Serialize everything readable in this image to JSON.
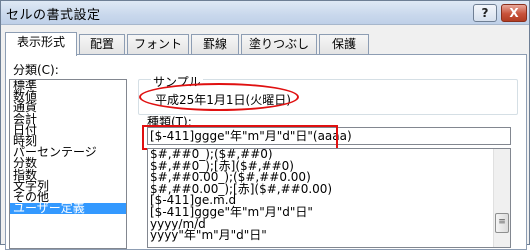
{
  "dialog": {
    "title": "セルの書式設定",
    "help_label": "?",
    "close_label": "X"
  },
  "tabs": [
    {
      "label": "表示形式",
      "active": true
    },
    {
      "label": "配置",
      "active": false
    },
    {
      "label": "フォント",
      "active": false
    },
    {
      "label": "罫線",
      "active": false
    },
    {
      "label": "塗りつぶし",
      "active": false
    },
    {
      "label": "保護",
      "active": false
    }
  ],
  "category": {
    "label": "分類(C):",
    "items": [
      "標準",
      "数値",
      "通貨",
      "会計",
      "日付",
      "時刻",
      "パーセンテージ",
      "分数",
      "指数",
      "文字列",
      "その他",
      "ユーザー定義"
    ],
    "selected": "ユーザー定義"
  },
  "sample": {
    "label": "サンプル",
    "value": "平成25年1月1日(火曜日)"
  },
  "format_type": {
    "label": "種類(T):",
    "value": "[$-411]ggge\"年\"m\"月\"d\"日\"(aaaa)",
    "items": [
      "$#,##0_);($#,##0)",
      "$#,##0_);[赤]($#,##0)",
      "$#,##0.00_);($#,##0.00)",
      "$#,##0.00_);[赤]($#,##0.00)",
      "[$-411]ge.m.d",
      "[$-411]ggge\"年\"m\"月\"d\"日\"",
      "yyyy/m/d",
      "yyyy\"年\"m\"月\"d\"日\""
    ]
  },
  "colors": {
    "highlight_red": "#e01010",
    "selection_blue": "#3399ff"
  }
}
